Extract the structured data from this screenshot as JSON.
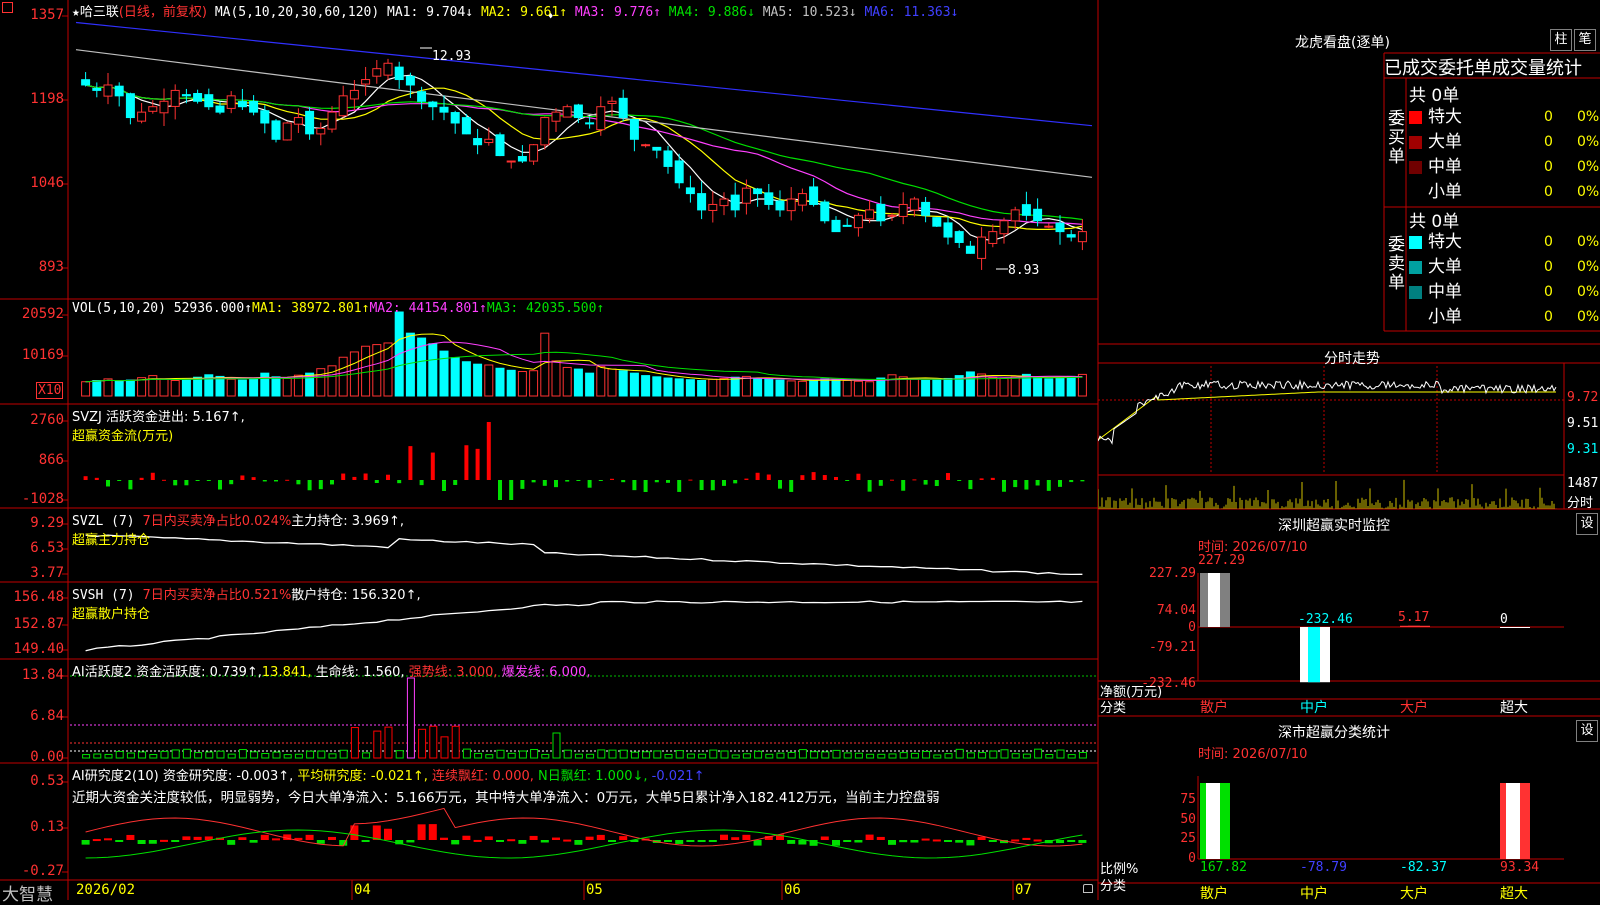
{
  "header": {
    "star": "★",
    "stock_name": "哈三联",
    "period": "(日线，前复权)",
    "ma_spec": "MA(5,10,20,30,60,120)",
    "ma1": "MA1: 9.704↓",
    "ma2": "MA2: 9.661↑",
    "ma3": "MA3: 9.776↑",
    "ma4": "MA4: 9.886↓",
    "ma5": "MA5: 10.523↓",
    "ma6": "MA6: 11.363↓",
    "marker": "♦",
    "high_label": "12.93",
    "low_label": "8.93"
  },
  "price_axis": [
    "1357",
    "1198",
    "1046",
    "893"
  ],
  "vol_panel": {
    "title": "VOL(5,10,20)",
    "value": "52936.000↑",
    "ma1": "MA1: 38972.801↑",
    "ma2": "MA2: 44154.801↑",
    "ma3": "MA3: 42035.500↑",
    "axis": [
      "20592",
      "10169"
    ],
    "unit": "X10"
  },
  "svzj_panel": {
    "line1": "SVZJ  活跃资金进出: 5.167↑,",
    "line2": "超赢资金流(万元)",
    "axis": [
      "2760",
      "866",
      "-1028"
    ]
  },
  "svzl_panel": {
    "line1a": "SVZL (7)",
    "line1b": "7日内买卖净占比0.024%",
    "line1c": "主力持仓: 3.969↑,",
    "line2": "超赢主力持仓",
    "axis": [
      "9.29",
      "6.53",
      "3.77"
    ]
  },
  "svsh_panel": {
    "line1a": "SVSH (7)",
    "line1b": "7日内买卖净占比0.521%",
    "line1c": "散户持仓: 156.320↑,",
    "line2": "超赢散户持仓",
    "axis": [
      "156.48",
      "152.87",
      "149.40"
    ]
  },
  "ai_active_panel": {
    "l_a": "AI活跃度2",
    "l_b": "资金活跃度: 0.739↑,",
    "l_c": "13.841,",
    "l_d": "生命线: 1.560,",
    "l_e": "强势线: 3.000,",
    "l_f": "爆发线: 6.000,",
    "axis": [
      "13.84",
      "6.84",
      "0.00"
    ]
  },
  "ai_research_panel": {
    "l_a": "AI研究度2(10)",
    "l_b": "资金研究度: -0.003↑,",
    "l_c": "平均研究度: -0.021↑,",
    "l_d": "连续飘红: 0.000,",
    "l_e": "N日飘红: 1.000↓,",
    "l_f": "-0.021↑",
    "note": "近期大资金关注度较低，明显弱势，今日大单净流入：5.166万元，其中特大单净流入：0万元，大单5日累计净入182.412万元，当前主力控盘弱",
    "axis": [
      "0.53",
      "0.13",
      "-0.27"
    ]
  },
  "time_axis": [
    "2026/02",
    "04",
    "05",
    "06",
    "07"
  ],
  "brand": "大智慧",
  "lhb": {
    "title": "龙虎看盘(逐单)",
    "btn_zhu": "柱",
    "btn_bi": "笔",
    "header": "已成交委托单成交量统计",
    "buy_label": "委买单",
    "sell_label": "委卖单",
    "buy_total": "共 0单",
    "sell_total": "共 0单",
    "buy_rows": [
      {
        "name": "特大",
        "count": "0",
        "pct": "0%",
        "color": "#ff0000"
      },
      {
        "name": "大单",
        "count": "0",
        "pct": "0%",
        "color": "#a00000"
      },
      {
        "name": "中单",
        "count": "0",
        "pct": "0%",
        "color": "#700000"
      },
      {
        "name": "小单",
        "count": "0",
        "pct": "0%",
        "color": "#000000"
      }
    ],
    "sell_rows": [
      {
        "name": "特大",
        "count": "0",
        "pct": "0%",
        "color": "#00ffff"
      },
      {
        "name": "大单",
        "count": "0",
        "pct": "0%",
        "color": "#00a0a0"
      },
      {
        "name": "中单",
        "count": "0",
        "pct": "0%",
        "color": "#008080"
      },
      {
        "name": "小单",
        "count": "0",
        "pct": "0%",
        "color": "#000000"
      }
    ]
  },
  "intraday": {
    "title": "分时走势",
    "axis": [
      "9.72",
      "9.51",
      "9.31"
    ],
    "vol_axis": [
      "1487",
      "分时"
    ]
  },
  "sz_monitor": {
    "title": "深圳超赢实时监控",
    "btn": "设",
    "time": "时间: 2026/07/10",
    "axis": [
      "227.29",
      "74.04",
      "0",
      "-79.21",
      "-232.46"
    ],
    "unit1": "净额(万元)",
    "unit2": "分类",
    "values": [
      "227.29",
      "-232.46",
      "5.17",
      "0"
    ],
    "categories": [
      "散户",
      "中户",
      "大户",
      "超大"
    ]
  },
  "sz_class": {
    "title": "深市超赢分类统计",
    "btn": "设",
    "time": "时间: 2026/07/10",
    "axis": [
      "75",
      "50",
      "25",
      "0"
    ],
    "unit1": "比例%",
    "unit2": "分类",
    "values": [
      "167.82",
      "-78.79",
      "-82.37",
      "93.34"
    ],
    "categories": [
      "散户",
      "中户",
      "大户",
      "超大"
    ]
  },
  "chart_data": [
    {
      "type": "candlestick",
      "title": "哈三联 (日线，前复权)",
      "ylim": [
        8.93,
        13.57
      ],
      "ma_values": {
        "MA1": 9.704,
        "MA2": 9.661,
        "MA3": 9.776,
        "MA4": 9.886,
        "MA5": 10.523,
        "MA6": 11.363
      },
      "high": 12.93,
      "low": 8.93,
      "colors": {
        "up": "#ff3232",
        "down": "#00ffff",
        "MA1": "#ffffff",
        "MA2": "#ffff00",
        "MA3": "#ff40ff",
        "MA4": "#00e000",
        "MA5": "#c0c0c0",
        "MA6": "#3030ff"
      },
      "closes": [
        12.3,
        12.2,
        12.3,
        12.1,
        11.7,
        11.8,
        11.9,
        12.0,
        12.2,
        12.1,
        12.0,
        11.9,
        11.8,
        12.1,
        11.9,
        11.8,
        11.6,
        11.3,
        11.6,
        11.7,
        11.4,
        11.5,
        11.8,
        12.1,
        12.2,
        12.4,
        12.6,
        12.7,
        12.4,
        12.3,
        12.0,
        11.9,
        11.8,
        11.6,
        11.4,
        11.2,
        11.3,
        11.0,
        10.9,
        10.9,
        11.2,
        11.7,
        11.8,
        11.9,
        11.7,
        11.6,
        11.9,
        12.0,
        11.7,
        11.3,
        11.2,
        11.1,
        10.8,
        10.5,
        10.3,
        10.0,
        10.1,
        10.2,
        10.0,
        10.4,
        10.3,
        10.1,
        10.0,
        10.2,
        10.3,
        10.1,
        9.8,
        9.6,
        9.7,
        9.9,
        10.0,
        9.8,
        9.9,
        10.1,
        10.2,
        9.9,
        9.7,
        9.5,
        9.4,
        9.2,
        9.5,
        9.6,
        9.8,
        10.0,
        9.9,
        9.8,
        9.7,
        9.6,
        9.5,
        9.6
      ],
      "closes_note": "illustrative"
    },
    {
      "type": "bar",
      "title": "VOL(5,10,20)",
      "ylim": [
        0,
        20592
      ],
      "values": [
        3500,
        3800,
        4200,
        3600,
        3900,
        4500,
        5000,
        4200,
        3800,
        4100,
        4600,
        5200,
        4800,
        4100,
        3900,
        4400,
        5600,
        4700,
        4300,
        5100,
        5600,
        6700,
        7400,
        9500,
        10800,
        12200,
        12600,
        13000,
        20592,
        15400,
        14200,
        12800,
        11000,
        9400,
        8400,
        7800,
        7600,
        6800,
        6300,
        6000,
        6200,
        15400,
        8600,
        7000,
        6600,
        5600,
        7200,
        6600,
        6200,
        5600,
        5000,
        4700,
        4400,
        4200,
        4000,
        3800,
        4100,
        4300,
        4600,
        4800,
        4400,
        4100,
        3900,
        3700,
        3600,
        3800,
        4200,
        4000,
        3800,
        3600,
        3500,
        4400,
        5200,
        4700,
        4100,
        3800,
        3900,
        4300,
        5000,
        5900,
        5400,
        4500,
        4300,
        4700,
        5300,
        4600,
        4200,
        4400,
        4800,
        5294
      ],
      "ma_values": {
        "MA1": 38972.801,
        "MA2": 44154.801,
        "MA3": 42035.5
      }
    },
    {
      "type": "bar",
      "title": "SVZJ 活跃资金进出",
      "ylim": [
        -1028,
        2760
      ],
      "last_value": 5.167
    },
    {
      "type": "line",
      "title": "SVZL 主力持仓",
      "ylim": [
        3.77,
        9.29
      ],
      "last_value": 3.969
    },
    {
      "type": "line",
      "title": "SVSH 散户持仓",
      "ylim": [
        149.4,
        156.48
      ],
      "last_value": 156.32
    },
    {
      "type": "bar",
      "title": "AI活跃度2",
      "ylim": [
        0,
        13.84
      ],
      "values": {
        "资金活跃度": 0.739,
        "生命线": 1.56,
        "强势线": 3.0,
        "爆发线": 6.0
      }
    },
    {
      "type": "bar",
      "title": "AI研究度2(10)",
      "ylim": [
        -0.27,
        0.53
      ],
      "values": {
        "资金研究度": -0.003,
        "平均研究度": -0.021,
        "连续飘红": 0.0,
        "N日飘红": 1.0
      }
    },
    {
      "type": "bar",
      "title": "深圳超赢实时监控",
      "categories": [
        "散户",
        "中户",
        "大户",
        "超大"
      ],
      "values": [
        227.29,
        -232.46,
        5.17,
        0
      ],
      "ylim": [
        -232.46,
        227.29
      ]
    },
    {
      "type": "bar",
      "title": "深市超赢分类统计",
      "categories": [
        "散户",
        "中户",
        "大户",
        "超大"
      ],
      "values": [
        167.82,
        -78.79,
        -82.37,
        93.34
      ],
      "ylim": [
        0,
        75
      ]
    }
  ]
}
